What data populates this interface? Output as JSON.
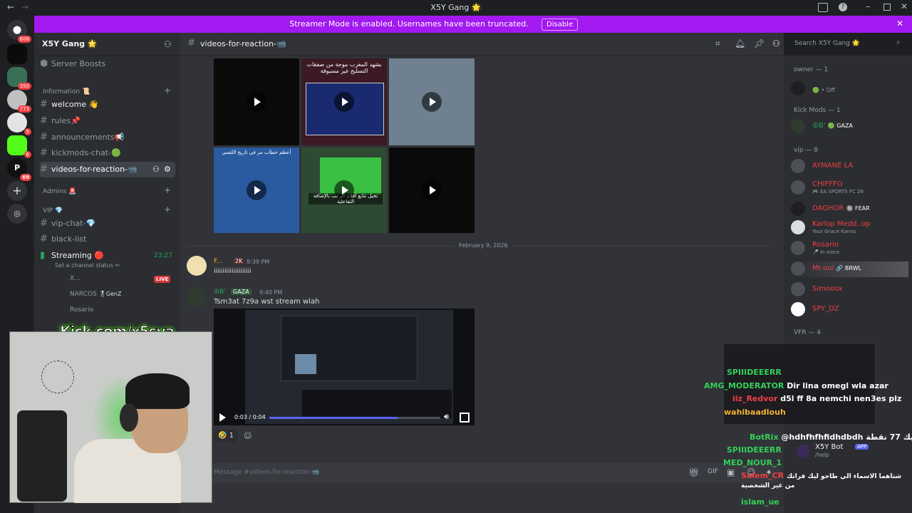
{
  "window": {
    "title": "X5Y Gang 🌟"
  },
  "banner": {
    "message": "Streamer Mode is enabled. Usernames have been truncated.",
    "button": "Disable"
  },
  "servers": [
    {
      "badge": "608"
    },
    {
      "badge": ""
    },
    {
      "badge": "350"
    },
    {
      "badge": "773"
    },
    {
      "badge": "5"
    },
    {
      "badge": "6"
    },
    {
      "badge": "69"
    }
  ],
  "sidebar": {
    "server_name": "X5Y Gang 🌟",
    "boosts": "Server Boosts",
    "categories": {
      "information": "Information 📜",
      "admins": "Admins 🚨",
      "vip": "VIP 💎"
    },
    "channels": {
      "welcome": "welcome 👋",
      "rules": "rules📌",
      "announcements": "announcements📢",
      "kickmods": "kickmods-chat-🟢",
      "videos": "videos-for-reaction-📹",
      "vipchat": "vip-chat-💎",
      "blacklist": "black-list",
      "streaming": "Streaming 🔴",
      "stream_status": "Set a channel status ✏",
      "stream_time": "23:27"
    },
    "voice_users": [
      {
        "name": "X...",
        "tag": "LIVE"
      },
      {
        "name": "NARCOS",
        "tag": "🎖GenZ"
      },
      {
        "name": "Rosario",
        "tag": ""
      }
    ]
  },
  "header": {
    "channel": "videos-for-reaction-📹",
    "search_placeholder": "Search X5Y Gang 🌟"
  },
  "thumbs": {
    "top_caption": "بشهد المغرب موجة من صفقات التسليح غير مسبوقة",
    "left_caption": "أعظم حطاب مر في تاريخ اللقمي",
    "green_caption": "تخيل تتابع أفلام الرعب بالإضافة التفاعلية"
  },
  "divider": {
    "date": "February 9, 2026"
  },
  "messages": [
    {
      "author": "F...",
      "badge": "2K",
      "time": "9:39 PM",
      "text": "iiiiiiiiiiiiiiiiiiiii"
    },
    {
      "author": "☮B'",
      "badge": "GAZA",
      "time": "9:40 PM",
      "text": "Tsm3at 7z9a wst stream wlah"
    }
  ],
  "video": {
    "time": "0:03 / 0:04",
    "progress": 0.75
  },
  "reaction": {
    "emoji": "🤣",
    "count": "1"
  },
  "composer": {
    "placeholder": "Message #videos-for-reaction-📹"
  },
  "members": {
    "groups": [
      {
        "label": "owner — 1"
      },
      {
        "label": "Kick Mods — 1"
      },
      {
        "label": "vip — 8"
      },
      {
        "label": "VFR — 4"
      }
    ],
    "owner": {
      "status": "🟢 • Off"
    },
    "kickmod": {
      "name": "☮B'",
      "tag": "🟢 GAZA"
    },
    "vip": [
      {
        "name": "AYMANE LA",
        "sub": ""
      },
      {
        "name": "CHIFFFO",
        "sub": "🎮 EA SPORTS FC 26"
      },
      {
        "name": "DAGHOR",
        "sub": "🔘 FEAR"
      },
      {
        "name": "Karlop Medd..op",
        "sub": "Your Grace Kanos"
      },
      {
        "name": "Rosario",
        "sub": "🎤 In voice"
      },
      {
        "name": "Mr.oui",
        "sub": "🔗 BRWL"
      },
      {
        "name": "Simooox",
        "sub": ""
      },
      {
        "name": "SPY_DZ",
        "sub": ""
      }
    ]
  },
  "overlay": {
    "kick_url": "Kick.com/x5sya",
    "chat": [
      {
        "name": "SPIIIDEEERR",
        "msg": ""
      },
      {
        "name": "AMG_MODERATOR",
        "msg": "Dir lina omegl wla azar"
      },
      {
        "name": "iiz_Redvor",
        "msg": "d5l ff 8a nemchi nen3es plz"
      },
      {
        "name": "wahibaadlouh",
        "msg": ""
      },
      {
        "name": "BotRix",
        "msg": "@hdhfhfhfidhdbdh لديك 77 نقطة"
      },
      {
        "name": "SPIIIDEEERR",
        "msg": ""
      },
      {
        "name": "MED_NOUR_1",
        "msg": ""
      },
      {
        "name": "Salem_CR",
        "msg": "شتاهما الاسماء الي طاحو ليك فرانك من غير الشخصية"
      },
      {
        "name": "islam_ue",
        "msg": ""
      }
    ],
    "bot": {
      "name": "X5Y Bot",
      "tag": "APP",
      "cmd": "/help"
    }
  }
}
